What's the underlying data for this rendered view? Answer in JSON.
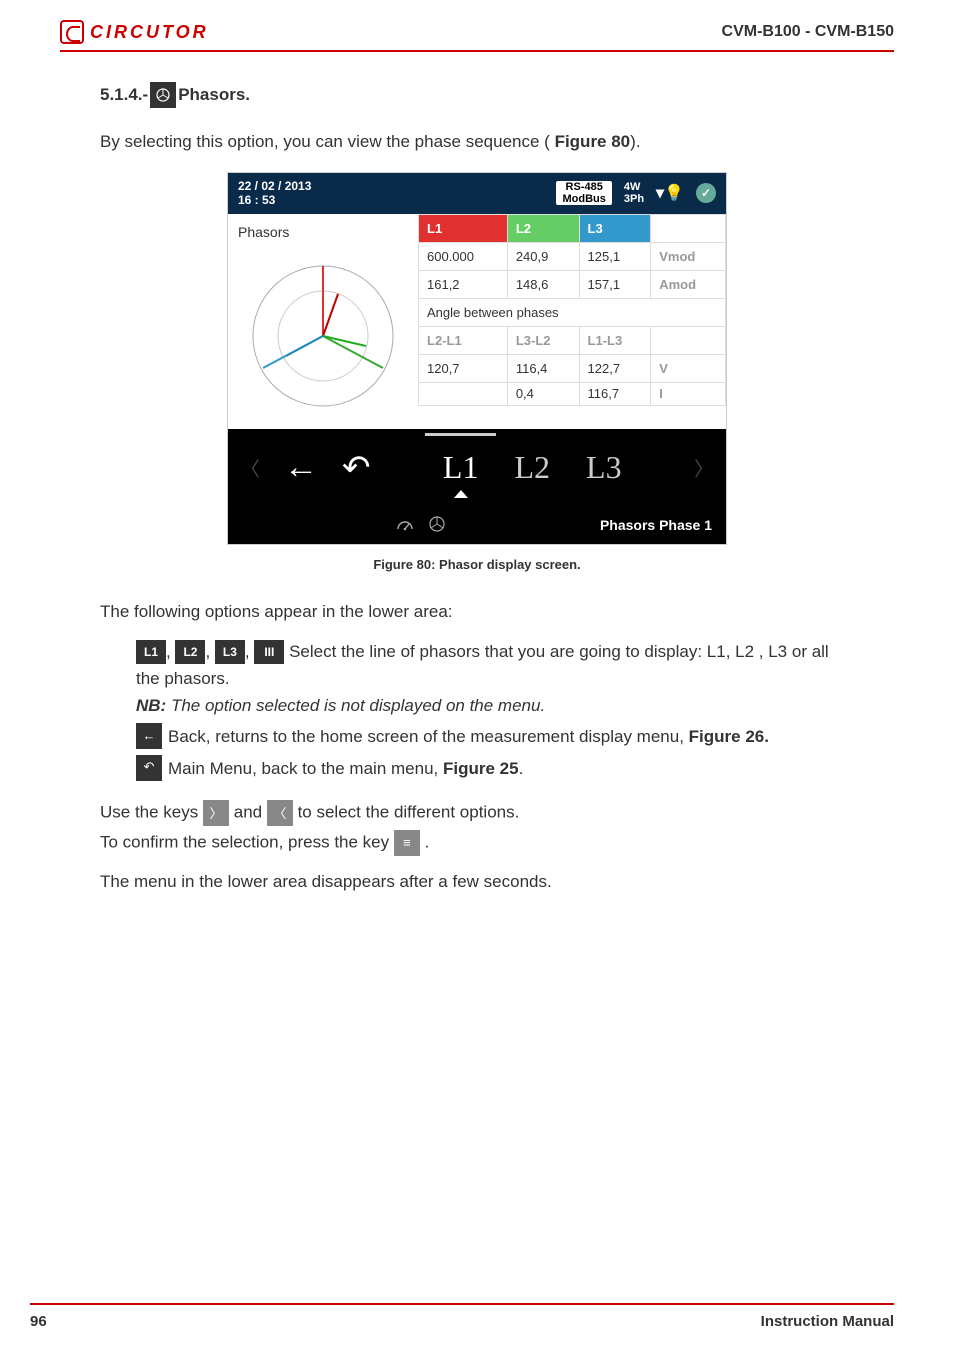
{
  "header": {
    "brand": "CIRCUTOR",
    "doc_code": "CVM-B100 - CVM-B150"
  },
  "section": {
    "number": "5.1.4.-",
    "title": " Phasors."
  },
  "intro": {
    "pre": "By selecting this option, you can view the phase sequence ( ",
    "fig_ref": "Figure 80",
    "post": ")."
  },
  "device": {
    "date": "22 / 02 / 2013",
    "time": "16 : 53",
    "rs_top": "RS-485",
    "rs_bot": "ModBus",
    "cfg_top": "4W",
    "cfg_bot": "3Ph",
    "panel_label": "Phasors",
    "table": {
      "h1": "L1",
      "h2": "L2",
      "h3": "L3",
      "r1": {
        "c1": "600.000",
        "c2": "240,9",
        "c3": "125,1",
        "unit": "Vmod"
      },
      "r2": {
        "c1": "161,2",
        "c2": "148,6",
        "c3": "157,1",
        "unit": "Amod"
      },
      "angle_label": "Angle between phases",
      "sh1": "L2-L1",
      "sh2": "L3-L2",
      "sh3": "L1-L3",
      "r3": {
        "c1": "120,7",
        "c2": "116,4",
        "c3": "122,7",
        "unit": "V"
      },
      "r4": {
        "c2": "0,4",
        "c3": "116,7",
        "unit": "I"
      }
    },
    "menu": {
      "l1": "L1",
      "l2": "L2",
      "l3": "L3"
    },
    "footer_label": "Phasors Phase 1"
  },
  "caption": "Figure 80: Phasor display screen.",
  "para_following": "The following options appear in the lower area:",
  "options": {
    "pill_l1": "L1",
    "pill_l2": "L2",
    "pill_l3": "L3",
    "pill_all": "III",
    "select_text": " Select the line of phasors that you are going to display: L1, L2 , L3 or all the phasors.",
    "nb_label": "NB:",
    "nb_text": " The option selected is not displayed on the menu.",
    "back_text": " Back, returns to the home screen of the measurement display menu, ",
    "back_ref": "Figure 26.",
    "menu_text": " Main Menu, back to the main menu, ",
    "menu_ref": "Figure 25",
    "menu_post": "."
  },
  "keys_para": {
    "pre": "Use the keys ",
    "mid": " and ",
    "post": " to select the different options."
  },
  "confirm_para": {
    "pre": "To confirm the selection, press the key ",
    "post": "."
  },
  "disappear": "The menu in the lower area disappears after a few seconds.",
  "footer": {
    "page": "96",
    "label": "Instruction Manual"
  }
}
